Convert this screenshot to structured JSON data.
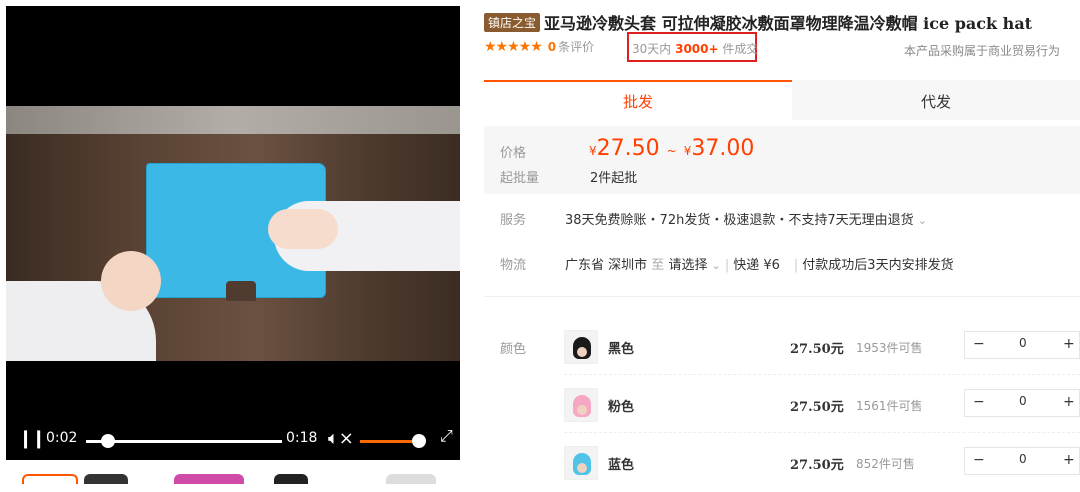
{
  "video": {
    "current_time": "0:02",
    "duration": "0:18",
    "progress": 0.11,
    "volume": 0.9
  },
  "product": {
    "badge": "镇店之宝",
    "title": "亚马逊冷敷头套 可拉伸凝胶冰敷面罩物理降温冷敷帽 ice pack hat",
    "stars": "★★★★★",
    "review_count": "0",
    "review_label": "条评价",
    "sold_prefix": "30天内",
    "sold_count": "3000+",
    "sold_suffix": "件成交",
    "trade_note": "本产品采购属于商业贸易行为"
  },
  "tabs": {
    "wholesale": "批发",
    "dropship": "代发"
  },
  "pricing": {
    "price_label": "价格",
    "currency": "¥",
    "price_min": "27.50",
    "range_sep": "~",
    "price_max": "37.00",
    "min_order_label": "起批量",
    "min_order": "2件起批"
  },
  "service": {
    "label": "服务",
    "text": "38天免费赊账・72h发货・极速退款・不支持7天无理由退货",
    "chevron": "⌄"
  },
  "logistics": {
    "label": "物流",
    "origin": "广东省 深圳市",
    "to": "至",
    "destination": "请选择",
    "method": "快递",
    "fee": "¥6",
    "note": "付款成功后3天内安排发货"
  },
  "variants": {
    "label": "颜色",
    "items": [
      {
        "name": "黑色",
        "price": "27.50元",
        "stock": "1953件可售",
        "qty": "0",
        "color": "#1a1a1a"
      },
      {
        "name": "粉色",
        "price": "27.50元",
        "stock": "1561件可售",
        "qty": "0",
        "color": "#f5a7c4"
      },
      {
        "name": "蓝色",
        "price": "27.50元",
        "stock": "852件可售",
        "qty": "0",
        "color": "#4fc3e8"
      }
    ],
    "minus": "−",
    "plus": "+"
  },
  "icons": {
    "pause": "pause-icon",
    "mute": "volume-mute-icon",
    "fullscreen": "fullscreen-icon"
  },
  "colors": {
    "accent": "#ff4000",
    "highlight_box": "#e02020"
  }
}
